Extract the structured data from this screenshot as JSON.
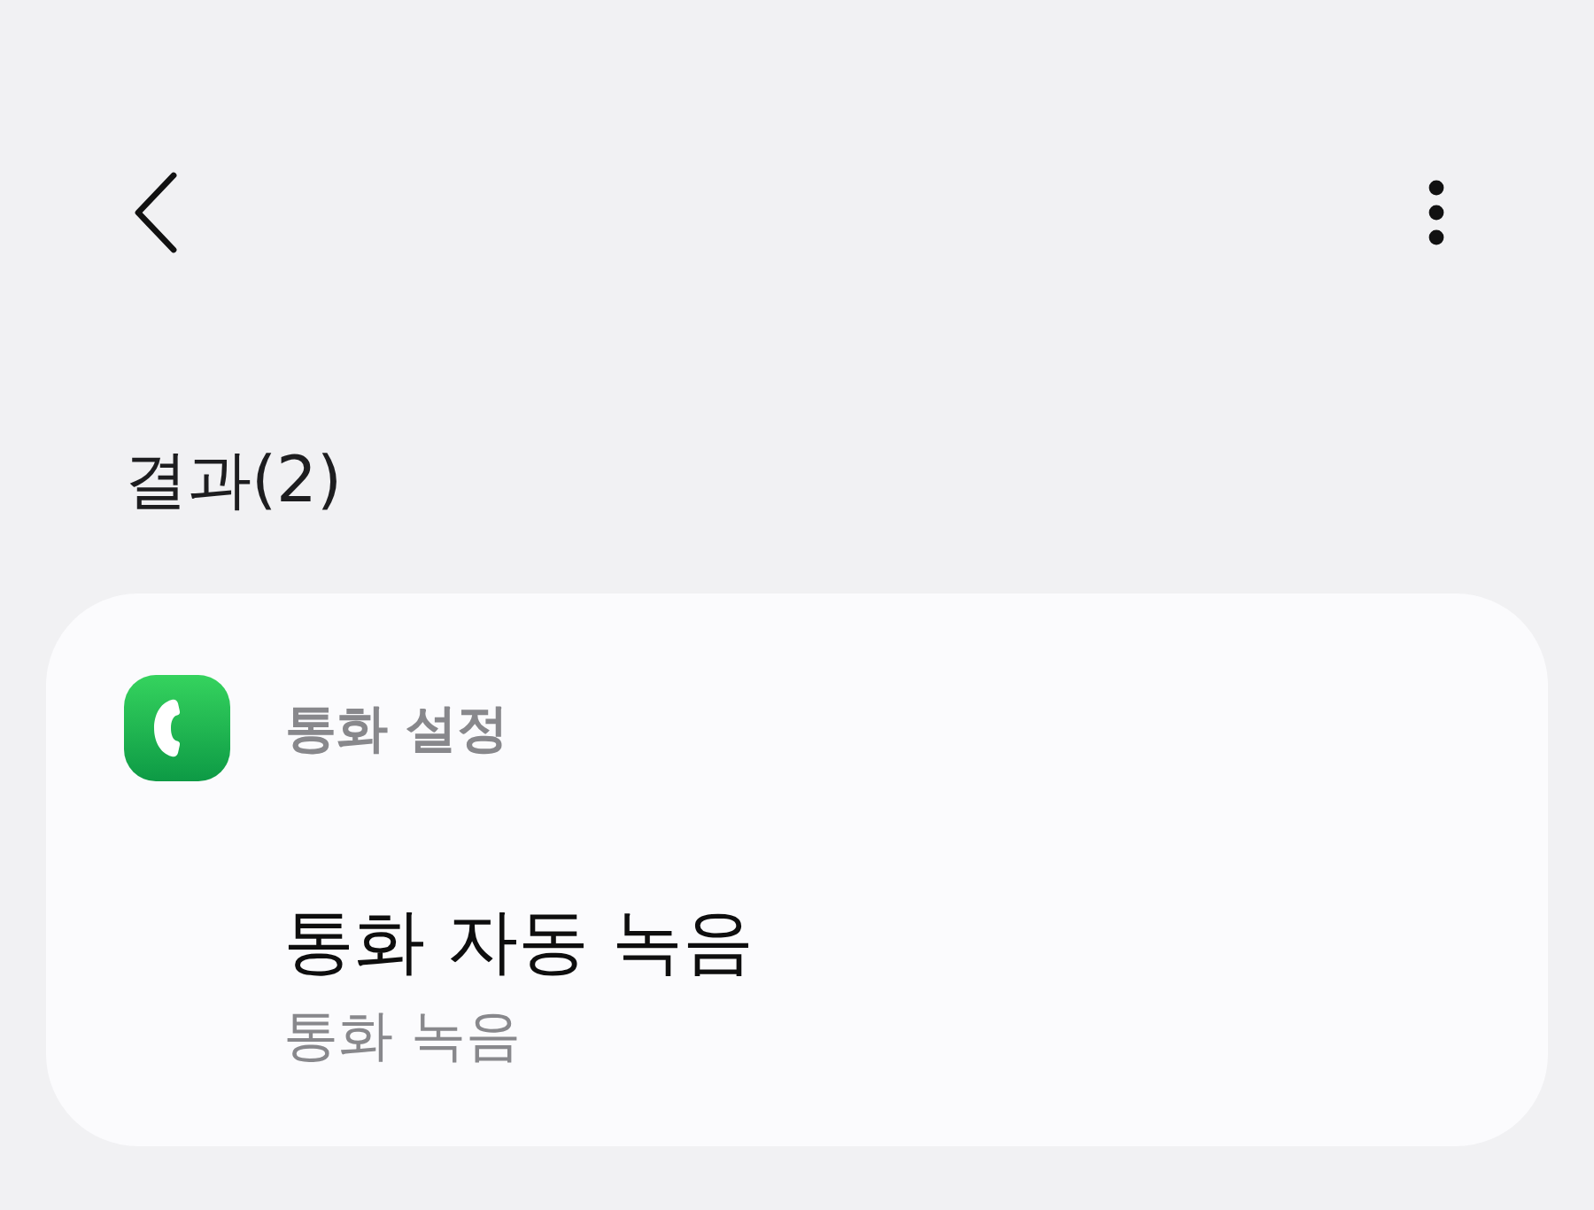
{
  "section_title": "결과(2)",
  "results": [
    {
      "app_name": "통화 설정",
      "items": [
        {
          "title": "통화 자동 녹음",
          "subtitle": "통화 녹음"
        }
      ]
    }
  ]
}
